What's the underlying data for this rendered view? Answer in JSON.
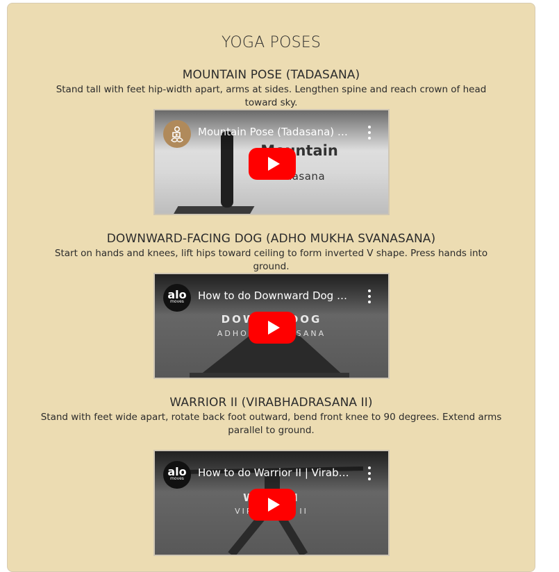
{
  "page": {
    "title": "YOGA POSES"
  },
  "poses": [
    {
      "name": "MOUNTAIN POSE (TADASANA)",
      "description": "Stand tall with feet hip-width apart, arms at sides. Lengthen spine and reach crown of head toward sky.",
      "video": {
        "title": "Mountain Pose (Tadasana) for Beginners",
        "overlay_title": "Mountain",
        "overlay_subtitle": "Tadasana",
        "channel_icon": "meditation-figure-icon"
      }
    },
    {
      "name": "DOWNWARD-FACING DOG (ADHO MUKHA SVANASANA)",
      "description": "Start on hands and knees, lift hips toward ceiling to form inverted V shape. Press hands into ground.",
      "video": {
        "title": "How to do Downward Dog | Adho Mukha Svanasana",
        "overlay_title": "DOWN    D DOG",
        "overlay_subtitle": "ADHO MU        ANASANA",
        "channel_label": "alo",
        "channel_sublabel": "moves"
      }
    },
    {
      "name": "WARRIOR II (VIRABHADRASANA II)",
      "description": "Stand with feet wide apart, rotate back foot outward, bend front knee to 90 degrees. Extend arms parallel to ground.",
      "video": {
        "title": "How to do Warrior II | Virabhadrasana II",
        "overlay_title": "WA    R II",
        "overlay_subtitle": "VIRAB        ANA II",
        "channel_label": "alo",
        "channel_sublabel": "moves"
      }
    }
  ]
}
